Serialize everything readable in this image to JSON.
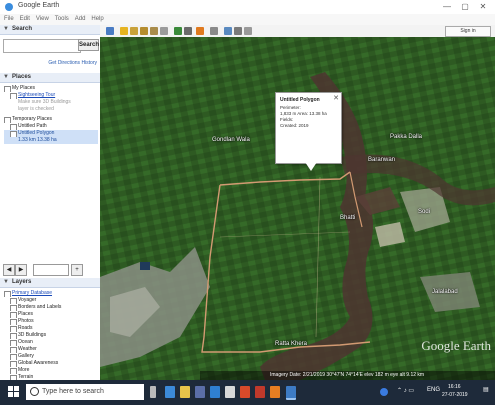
{
  "window": {
    "title": "Google Earth",
    "controls": [
      "—",
      "▢",
      "✕"
    ]
  },
  "menu": [
    "File",
    "Edit",
    "View",
    "Tools",
    "Add",
    "Help"
  ],
  "search_panel": {
    "title": "Search",
    "placeholder": "",
    "button": "Search",
    "history_link": "Get Directions  History"
  },
  "places_panel": {
    "title": "Places",
    "items": [
      {
        "label": "My Places",
        "style": "plain"
      },
      {
        "label": "Sightseeing Tour",
        "style": "link"
      },
      {
        "label": "Make sure 3D Buildings",
        "style": "gray"
      },
      {
        "label": "layer is checked",
        "style": "gray"
      },
      {
        "label": "Temporary Places",
        "style": "plain"
      },
      {
        "label": "Untitled Path",
        "style": "plain"
      },
      {
        "label": "Untitled Polygon",
        "style": "sel"
      },
      {
        "label": "1.33 km  13.38 ha",
        "style": "sel"
      }
    ]
  },
  "nav": {
    "add_label": "+",
    "back": "◀",
    "fwd": "▶"
  },
  "layers_panel": {
    "title": "Layers",
    "items": [
      "Primary Database",
      "Voyager",
      "Borders and Labels",
      "Places",
      "Photos",
      "Roads",
      "3D Buildings",
      "Ocean",
      "Weather",
      "Gallery",
      "Global Awareness",
      "More",
      "Terrain"
    ]
  },
  "toolbar": {
    "signin": "Sign in",
    "tools": [
      "sidebar",
      "placemark",
      "polygon",
      "path",
      "overlay",
      "tour",
      "history",
      "sun",
      "planets",
      "ruler",
      "email",
      "print",
      "maps"
    ]
  },
  "map": {
    "labels": [
      "Gondlan Wala",
      "Pakka Dalla",
      "Baranwan",
      "Bhatti",
      "Sodi",
      "Jalalabad",
      "Ratta Khera"
    ],
    "balloon": {
      "title": "Untitled Polygon",
      "lines": [
        "Perimeter:",
        "1,833 m  Area: 13.38 ha",
        "Fields:",
        "Created: 2019"
      ]
    },
    "watermark": "Google Earth",
    "imagery": "Imagery Date: 2/21/2019   30°47'N  74°14'E  elev 182 m  eye alt 9.12 km",
    "status": "Imagery ©2019 CNES / Airbus, Maxar Technologies"
  },
  "taskbar": {
    "search_placeholder": "Type here to search",
    "tray_lang": "ENG",
    "time": "16:16",
    "date": "27-07-2019"
  },
  "colors": {
    "map_green": "#2f5a23",
    "river": "#5a3b35",
    "boundary": "#c88a66",
    "taskbar": "#1e2a3a",
    "panel_head": "#e8eef7"
  }
}
